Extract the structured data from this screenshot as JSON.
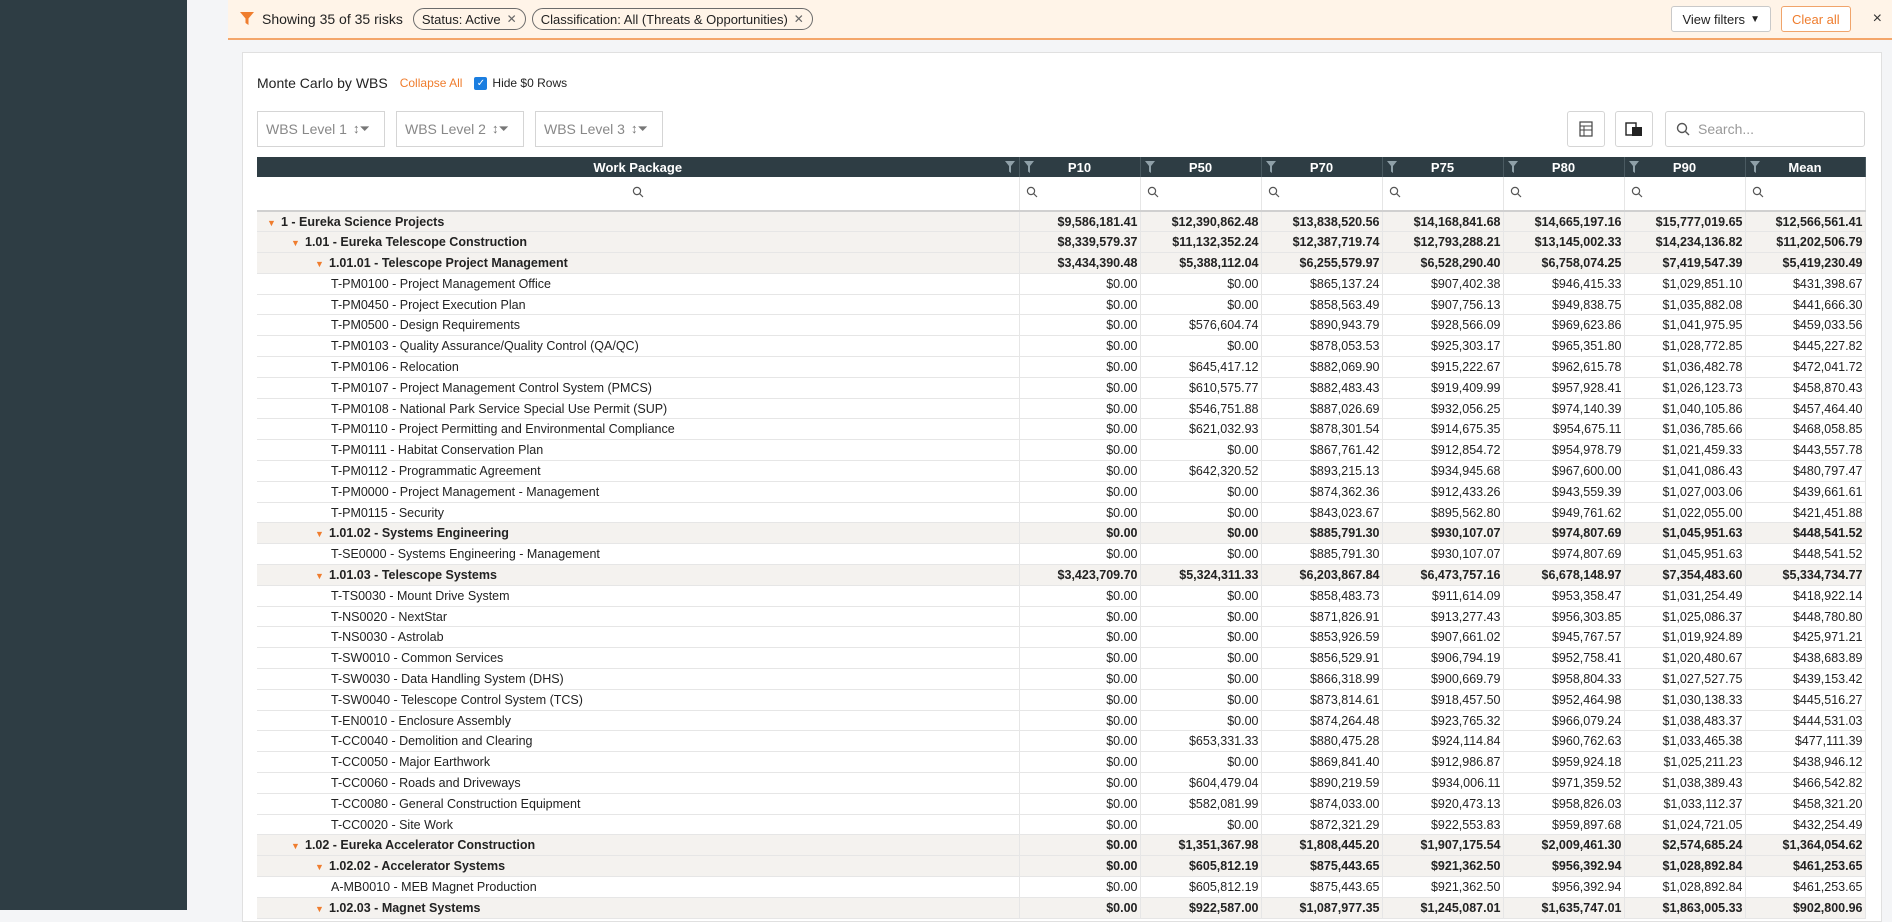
{
  "filter_bar": {
    "summary": "Showing 35 of 35 risks",
    "chips": [
      "Status: Active",
      "Classification: All (Threats & Opportunities)"
    ],
    "view_filters": "View filters",
    "clear_all": "Clear all",
    "close": "×"
  },
  "panel": {
    "title": "Monte Carlo by WBS",
    "collapse_all": "Collapse All",
    "hide_zero": "Hide $0 Rows",
    "group_boxes": [
      "WBS Level 1",
      "WBS Level 2",
      "WBS Level 3"
    ],
    "search_placeholder": "Search..."
  },
  "columns": [
    "Work Package",
    "P10",
    "P50",
    "P70",
    "P75",
    "P80",
    "P90",
    "Mean"
  ],
  "rows": [
    {
      "level": 0,
      "group": true,
      "label": "1 - Eureka Science Projects",
      "vals": [
        "$9,586,181.41",
        "$12,390,862.48",
        "$13,838,520.56",
        "$14,168,841.68",
        "$14,665,197.16",
        "$15,777,019.65",
        "$12,566,561.41"
      ]
    },
    {
      "level": 1,
      "group": true,
      "label": "1.01 - Eureka Telescope Construction",
      "vals": [
        "$8,339,579.37",
        "$11,132,352.24",
        "$12,387,719.74",
        "$12,793,288.21",
        "$13,145,002.33",
        "$14,234,136.82",
        "$11,202,506.79"
      ]
    },
    {
      "level": 2,
      "group": true,
      "label": "1.01.01 - Telescope Project Management",
      "vals": [
        "$3,434,390.48",
        "$5,388,112.04",
        "$6,255,579.97",
        "$6,528,290.40",
        "$6,758,074.25",
        "$7,419,547.39",
        "$5,419,230.49"
      ]
    },
    {
      "level": 3,
      "group": false,
      "label": "T-PM0100 - Project Management Office",
      "vals": [
        "$0.00",
        "$0.00",
        "$865,137.24",
        "$907,402.38",
        "$946,415.33",
        "$1,029,851.10",
        "$431,398.67"
      ]
    },
    {
      "level": 3,
      "group": false,
      "label": "T-PM0450 - Project Execution Plan",
      "vals": [
        "$0.00",
        "$0.00",
        "$858,563.49",
        "$907,756.13",
        "$949,838.75",
        "$1,035,882.08",
        "$441,666.30"
      ]
    },
    {
      "level": 3,
      "group": false,
      "label": "T-PM0500 - Design Requirements",
      "vals": [
        "$0.00",
        "$576,604.74",
        "$890,943.79",
        "$928,566.09",
        "$969,623.86",
        "$1,041,975.95",
        "$459,033.56"
      ]
    },
    {
      "level": 3,
      "group": false,
      "label": "T-PM0103 - Quality Assurance/Quality Control (QA/QC)",
      "vals": [
        "$0.00",
        "$0.00",
        "$878,053.53",
        "$925,303.17",
        "$965,351.80",
        "$1,028,772.85",
        "$445,227.82"
      ]
    },
    {
      "level": 3,
      "group": false,
      "label": "T-PM0106 - Relocation",
      "vals": [
        "$0.00",
        "$645,417.12",
        "$882,069.90",
        "$915,222.67",
        "$962,615.78",
        "$1,036,482.78",
        "$472,041.72"
      ]
    },
    {
      "level": 3,
      "group": false,
      "label": "T-PM0107 - Project Management Control System (PMCS)",
      "vals": [
        "$0.00",
        "$610,575.77",
        "$882,483.43",
        "$919,409.99",
        "$957,928.41",
        "$1,026,123.73",
        "$458,870.43"
      ]
    },
    {
      "level": 3,
      "group": false,
      "label": "T-PM0108 - National Park Service Special Use Permit (SUP)",
      "vals": [
        "$0.00",
        "$546,751.88",
        "$887,026.69",
        "$932,056.25",
        "$974,140.39",
        "$1,040,105.86",
        "$457,464.40"
      ]
    },
    {
      "level": 3,
      "group": false,
      "label": "T-PM0110 - Project Permitting and Environmental Compliance",
      "vals": [
        "$0.00",
        "$621,032.93",
        "$878,301.54",
        "$914,675.35",
        "$954,675.11",
        "$1,036,785.66",
        "$468,058.85"
      ]
    },
    {
      "level": 3,
      "group": false,
      "label": "T-PM0111 - Habitat Conservation Plan",
      "vals": [
        "$0.00",
        "$0.00",
        "$867,761.42",
        "$912,854.72",
        "$954,978.79",
        "$1,021,459.33",
        "$443,557.78"
      ]
    },
    {
      "level": 3,
      "group": false,
      "label": "T-PM0112 - Programmatic Agreement",
      "vals": [
        "$0.00",
        "$642,320.52",
        "$893,215.13",
        "$934,945.68",
        "$967,600.00",
        "$1,041,086.43",
        "$480,797.47"
      ]
    },
    {
      "level": 3,
      "group": false,
      "label": "T-PM0000 - Project Management - Management",
      "vals": [
        "$0.00",
        "$0.00",
        "$874,362.36",
        "$912,433.26",
        "$943,559.39",
        "$1,027,003.06",
        "$439,661.61"
      ]
    },
    {
      "level": 3,
      "group": false,
      "label": "T-PM0115 - Security",
      "vals": [
        "$0.00",
        "$0.00",
        "$843,023.67",
        "$895,562.80",
        "$949,761.62",
        "$1,022,055.00",
        "$421,451.88"
      ]
    },
    {
      "level": 2,
      "group": true,
      "label": "1.01.02 - Systems Engineering",
      "vals": [
        "$0.00",
        "$0.00",
        "$885,791.30",
        "$930,107.07",
        "$974,807.69",
        "$1,045,951.63",
        "$448,541.52"
      ]
    },
    {
      "level": 3,
      "group": false,
      "label": "T-SE0000 - Systems Engineering - Management",
      "vals": [
        "$0.00",
        "$0.00",
        "$885,791.30",
        "$930,107.07",
        "$974,807.69",
        "$1,045,951.63",
        "$448,541.52"
      ]
    },
    {
      "level": 2,
      "group": true,
      "label": "1.01.03 - Telescope Systems",
      "vals": [
        "$3,423,709.70",
        "$5,324,311.33",
        "$6,203,867.84",
        "$6,473,757.16",
        "$6,678,148.97",
        "$7,354,483.60",
        "$5,334,734.77"
      ]
    },
    {
      "level": 3,
      "group": false,
      "label": "T-TS0030 - Mount Drive System",
      "vals": [
        "$0.00",
        "$0.00",
        "$858,483.73",
        "$911,614.09",
        "$953,358.47",
        "$1,031,254.49",
        "$418,922.14"
      ]
    },
    {
      "level": 3,
      "group": false,
      "label": "T-NS0020 - NextStar",
      "vals": [
        "$0.00",
        "$0.00",
        "$871,826.91",
        "$913,277.43",
        "$956,303.85",
        "$1,025,086.37",
        "$448,780.80"
      ]
    },
    {
      "level": 3,
      "group": false,
      "label": "T-NS0030 - Astrolab",
      "vals": [
        "$0.00",
        "$0.00",
        "$853,926.59",
        "$907,661.02",
        "$945,767.57",
        "$1,019,924.89",
        "$425,971.21"
      ]
    },
    {
      "level": 3,
      "group": false,
      "label": "T-SW0010 - Common Services",
      "vals": [
        "$0.00",
        "$0.00",
        "$856,529.91",
        "$906,794.19",
        "$952,758.41",
        "$1,020,480.67",
        "$438,683.89"
      ]
    },
    {
      "level": 3,
      "group": false,
      "label": "T-SW0030 - Data Handling System (DHS)",
      "vals": [
        "$0.00",
        "$0.00",
        "$866,318.99",
        "$900,669.79",
        "$958,804.33",
        "$1,027,527.75",
        "$439,153.42"
      ]
    },
    {
      "level": 3,
      "group": false,
      "label": "T-SW0040 - Telescope Control System (TCS)",
      "vals": [
        "$0.00",
        "$0.00",
        "$873,814.61",
        "$918,457.50",
        "$952,464.98",
        "$1,030,138.33",
        "$445,516.27"
      ]
    },
    {
      "level": 3,
      "group": false,
      "label": "T-EN0010 - Enclosure Assembly",
      "vals": [
        "$0.00",
        "$0.00",
        "$874,264.48",
        "$923,765.32",
        "$966,079.24",
        "$1,038,483.37",
        "$444,531.03"
      ]
    },
    {
      "level": 3,
      "group": false,
      "label": "T-CC0040 - Demolition and Clearing",
      "vals": [
        "$0.00",
        "$653,331.33",
        "$880,475.28",
        "$924,114.84",
        "$960,762.63",
        "$1,033,465.38",
        "$477,111.39"
      ]
    },
    {
      "level": 3,
      "group": false,
      "label": "T-CC0050 - Major Earthwork",
      "vals": [
        "$0.00",
        "$0.00",
        "$869,841.40",
        "$912,986.87",
        "$959,924.18",
        "$1,025,211.23",
        "$438,946.12"
      ]
    },
    {
      "level": 3,
      "group": false,
      "label": "T-CC0060 - Roads and Driveways",
      "vals": [
        "$0.00",
        "$604,479.04",
        "$890,219.59",
        "$934,006.11",
        "$971,359.52",
        "$1,038,389.43",
        "$466,542.82"
      ]
    },
    {
      "level": 3,
      "group": false,
      "label": "T-CC0080 - General Construction Equipment",
      "vals": [
        "$0.00",
        "$582,081.99",
        "$874,033.00",
        "$920,473.13",
        "$958,826.03",
        "$1,033,112.37",
        "$458,321.20"
      ]
    },
    {
      "level": 3,
      "group": false,
      "label": "T-CC0020 - Site Work",
      "vals": [
        "$0.00",
        "$0.00",
        "$872,321.29",
        "$922,553.83",
        "$959,897.68",
        "$1,024,721.05",
        "$432,254.49"
      ]
    },
    {
      "level": 1,
      "group": true,
      "label": "1.02 - Eureka Accelerator Construction",
      "vals": [
        "$0.00",
        "$1,351,367.98",
        "$1,808,445.20",
        "$1,907,175.54",
        "$2,009,461.30",
        "$2,574,685.24",
        "$1,364,054.62"
      ]
    },
    {
      "level": 2,
      "group": true,
      "label": "1.02.02 - Accelerator Systems",
      "vals": [
        "$0.00",
        "$605,812.19",
        "$875,443.65",
        "$921,362.50",
        "$956,392.94",
        "$1,028,892.84",
        "$461,253.65"
      ]
    },
    {
      "level": 3,
      "group": false,
      "label": "A-MB0010 - MEB Magnet Production",
      "vals": [
        "$0.00",
        "$605,812.19",
        "$875,443.65",
        "$921,362.50",
        "$956,392.94",
        "$1,028,892.84",
        "$461,253.65"
      ]
    },
    {
      "level": 2,
      "group": true,
      "label": "1.02.03 - Magnet Systems",
      "vals": [
        "$0.00",
        "$922,587.00",
        "$1,087,977.35",
        "$1,245,087.01",
        "$1,635,747.01",
        "$1,863,005.33",
        "$902,800.96"
      ]
    }
  ]
}
